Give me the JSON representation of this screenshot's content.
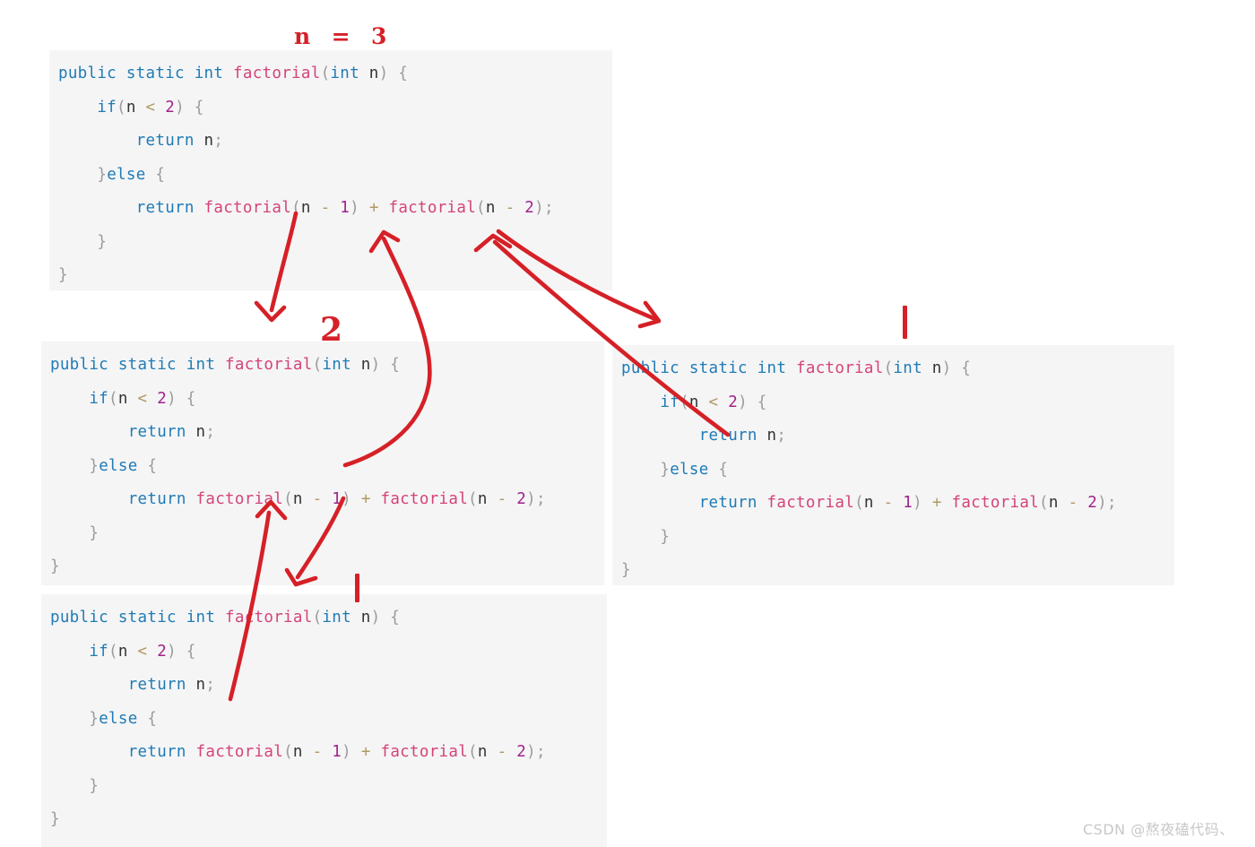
{
  "title": {
    "text": "n  =  3",
    "color": "#D62027"
  },
  "syntax_colors": {
    "keyword": "#1F7BB6",
    "function": "#D4437A",
    "punctuation": "#9b9b9b",
    "variable": "#333333",
    "number": "#A0228C",
    "operator": "#B09A63",
    "block_background": "#f5f5f5",
    "annotation_red": "#D62027"
  },
  "code_blocks": [
    {
      "id": "block-top-left",
      "lines": [
        [
          {
            "t": "public static int ",
            "c": "kw"
          },
          {
            "t": "factorial",
            "c": "fn"
          },
          {
            "t": "(",
            "c": "pun"
          },
          {
            "t": "int",
            "c": "kw"
          },
          {
            "t": " ",
            "c": "pun"
          },
          {
            "t": "n",
            "c": "var"
          },
          {
            "t": ")",
            "c": "pun"
          },
          {
            "t": " {",
            "c": "pun"
          }
        ],
        [
          {
            "t": "    ",
            "c": "pun"
          },
          {
            "t": "if",
            "c": "kw"
          },
          {
            "t": "(",
            "c": "pun"
          },
          {
            "t": "n",
            "c": "var"
          },
          {
            "t": " ",
            "c": "pun"
          },
          {
            "t": "<",
            "c": "op"
          },
          {
            "t": " ",
            "c": "pun"
          },
          {
            "t": "2",
            "c": "num"
          },
          {
            "t": ")",
            "c": "pun"
          },
          {
            "t": " {",
            "c": "pun"
          }
        ],
        [
          {
            "t": "        ",
            "c": "pun"
          },
          {
            "t": "return",
            "c": "kw"
          },
          {
            "t": " ",
            "c": "pun"
          },
          {
            "t": "n",
            "c": "var"
          },
          {
            "t": ";",
            "c": "pun"
          }
        ],
        [
          {
            "t": "    ",
            "c": "pun"
          },
          {
            "t": "}",
            "c": "pun"
          },
          {
            "t": "else",
            "c": "kw"
          },
          {
            "t": " {",
            "c": "pun"
          }
        ],
        [
          {
            "t": "        ",
            "c": "pun"
          },
          {
            "t": "return",
            "c": "kw"
          },
          {
            "t": " ",
            "c": "pun"
          },
          {
            "t": "factorial",
            "c": "fn"
          },
          {
            "t": "(",
            "c": "pun"
          },
          {
            "t": "n",
            "c": "var"
          },
          {
            "t": " ",
            "c": "pun"
          },
          {
            "t": "-",
            "c": "op"
          },
          {
            "t": " ",
            "c": "pun"
          },
          {
            "t": "1",
            "c": "num"
          },
          {
            "t": ")",
            "c": "pun"
          },
          {
            "t": " ",
            "c": "pun"
          },
          {
            "t": "+",
            "c": "op"
          },
          {
            "t": " ",
            "c": "pun"
          },
          {
            "t": "factorial",
            "c": "fn"
          },
          {
            "t": "(",
            "c": "pun"
          },
          {
            "t": "n",
            "c": "var"
          },
          {
            "t": " ",
            "c": "pun"
          },
          {
            "t": "-",
            "c": "op"
          },
          {
            "t": " ",
            "c": "pun"
          },
          {
            "t": "2",
            "c": "num"
          },
          {
            "t": ");",
            "c": "pun"
          }
        ],
        [
          {
            "t": "    ",
            "c": "pun"
          },
          {
            "t": "}",
            "c": "pun"
          }
        ],
        [
          {
            "t": "}",
            "c": "pun"
          }
        ]
      ]
    },
    {
      "id": "block-middle-left",
      "lines": [
        [
          {
            "t": "public static int ",
            "c": "kw"
          },
          {
            "t": "factorial",
            "c": "fn"
          },
          {
            "t": "(",
            "c": "pun"
          },
          {
            "t": "int",
            "c": "kw"
          },
          {
            "t": " ",
            "c": "pun"
          },
          {
            "t": "n",
            "c": "var"
          },
          {
            "t": ")",
            "c": "pun"
          },
          {
            "t": " {",
            "c": "pun"
          }
        ],
        [
          {
            "t": "    ",
            "c": "pun"
          },
          {
            "t": "if",
            "c": "kw"
          },
          {
            "t": "(",
            "c": "pun"
          },
          {
            "t": "n",
            "c": "var"
          },
          {
            "t": " ",
            "c": "pun"
          },
          {
            "t": "<",
            "c": "op"
          },
          {
            "t": " ",
            "c": "pun"
          },
          {
            "t": "2",
            "c": "num"
          },
          {
            "t": ")",
            "c": "pun"
          },
          {
            "t": " {",
            "c": "pun"
          }
        ],
        [
          {
            "t": "        ",
            "c": "pun"
          },
          {
            "t": "return",
            "c": "kw"
          },
          {
            "t": " ",
            "c": "pun"
          },
          {
            "t": "n",
            "c": "var"
          },
          {
            "t": ";",
            "c": "pun"
          }
        ],
        [
          {
            "t": "    ",
            "c": "pun"
          },
          {
            "t": "}",
            "c": "pun"
          },
          {
            "t": "else",
            "c": "kw"
          },
          {
            "t": " {",
            "c": "pun"
          }
        ],
        [
          {
            "t": "        ",
            "c": "pun"
          },
          {
            "t": "return",
            "c": "kw"
          },
          {
            "t": " ",
            "c": "pun"
          },
          {
            "t": "factorial",
            "c": "fn"
          },
          {
            "t": "(",
            "c": "pun"
          },
          {
            "t": "n",
            "c": "var"
          },
          {
            "t": " ",
            "c": "pun"
          },
          {
            "t": "-",
            "c": "op"
          },
          {
            "t": " ",
            "c": "pun"
          },
          {
            "t": "1",
            "c": "num"
          },
          {
            "t": ")",
            "c": "pun"
          },
          {
            "t": " ",
            "c": "pun"
          },
          {
            "t": "+",
            "c": "op"
          },
          {
            "t": " ",
            "c": "pun"
          },
          {
            "t": "factorial",
            "c": "fn"
          },
          {
            "t": "(",
            "c": "pun"
          },
          {
            "t": "n",
            "c": "var"
          },
          {
            "t": " ",
            "c": "pun"
          },
          {
            "t": "-",
            "c": "op"
          },
          {
            "t": " ",
            "c": "pun"
          },
          {
            "t": "2",
            "c": "num"
          },
          {
            "t": ");",
            "c": "pun"
          }
        ],
        [
          {
            "t": "    ",
            "c": "pun"
          },
          {
            "t": "}",
            "c": "pun"
          }
        ],
        [
          {
            "t": "}",
            "c": "pun"
          }
        ]
      ]
    },
    {
      "id": "block-bottom-left",
      "lines": [
        [
          {
            "t": "public static int ",
            "c": "kw"
          },
          {
            "t": "factorial",
            "c": "fn"
          },
          {
            "t": "(",
            "c": "pun"
          },
          {
            "t": "int",
            "c": "kw"
          },
          {
            "t": " ",
            "c": "pun"
          },
          {
            "t": "n",
            "c": "var"
          },
          {
            "t": ")",
            "c": "pun"
          },
          {
            "t": " {",
            "c": "pun"
          }
        ],
        [
          {
            "t": "    ",
            "c": "pun"
          },
          {
            "t": "if",
            "c": "kw"
          },
          {
            "t": "(",
            "c": "pun"
          },
          {
            "t": "n",
            "c": "var"
          },
          {
            "t": " ",
            "c": "pun"
          },
          {
            "t": "<",
            "c": "op"
          },
          {
            "t": " ",
            "c": "pun"
          },
          {
            "t": "2",
            "c": "num"
          },
          {
            "t": ")",
            "c": "pun"
          },
          {
            "t": " {",
            "c": "pun"
          }
        ],
        [
          {
            "t": "        ",
            "c": "pun"
          },
          {
            "t": "return",
            "c": "kw"
          },
          {
            "t": " ",
            "c": "pun"
          },
          {
            "t": "n",
            "c": "var"
          },
          {
            "t": ";",
            "c": "pun"
          }
        ],
        [
          {
            "t": "    ",
            "c": "pun"
          },
          {
            "t": "}",
            "c": "pun"
          },
          {
            "t": "else",
            "c": "kw"
          },
          {
            "t": " {",
            "c": "pun"
          }
        ],
        [
          {
            "t": "        ",
            "c": "pun"
          },
          {
            "t": "return",
            "c": "kw"
          },
          {
            "t": " ",
            "c": "pun"
          },
          {
            "t": "factorial",
            "c": "fn"
          },
          {
            "t": "(",
            "c": "pun"
          },
          {
            "t": "n",
            "c": "var"
          },
          {
            "t": " ",
            "c": "pun"
          },
          {
            "t": "-",
            "c": "op"
          },
          {
            "t": " ",
            "c": "pun"
          },
          {
            "t": "1",
            "c": "num"
          },
          {
            "t": ")",
            "c": "pun"
          },
          {
            "t": " ",
            "c": "pun"
          },
          {
            "t": "+",
            "c": "op"
          },
          {
            "t": " ",
            "c": "pun"
          },
          {
            "t": "factorial",
            "c": "fn"
          },
          {
            "t": "(",
            "c": "pun"
          },
          {
            "t": "n",
            "c": "var"
          },
          {
            "t": " ",
            "c": "pun"
          },
          {
            "t": "-",
            "c": "op"
          },
          {
            "t": " ",
            "c": "pun"
          },
          {
            "t": "2",
            "c": "num"
          },
          {
            "t": ");",
            "c": "pun"
          }
        ],
        [
          {
            "t": "    ",
            "c": "pun"
          },
          {
            "t": "}",
            "c": "pun"
          }
        ],
        [
          {
            "t": "}",
            "c": "pun"
          }
        ]
      ]
    },
    {
      "id": "block-right",
      "lines": [
        [
          {
            "t": "public static int ",
            "c": "kw"
          },
          {
            "t": "factorial",
            "c": "fn"
          },
          {
            "t": "(",
            "c": "pun"
          },
          {
            "t": "int",
            "c": "kw"
          },
          {
            "t": " ",
            "c": "pun"
          },
          {
            "t": "n",
            "c": "var"
          },
          {
            "t": ")",
            "c": "pun"
          },
          {
            "t": " {",
            "c": "pun"
          }
        ],
        [
          {
            "t": "    ",
            "c": "pun"
          },
          {
            "t": "if",
            "c": "kw"
          },
          {
            "t": "(",
            "c": "pun"
          },
          {
            "t": "n",
            "c": "var"
          },
          {
            "t": " ",
            "c": "pun"
          },
          {
            "t": "<",
            "c": "op"
          },
          {
            "t": " ",
            "c": "pun"
          },
          {
            "t": "2",
            "c": "num"
          },
          {
            "t": ")",
            "c": "pun"
          },
          {
            "t": " {",
            "c": "pun"
          }
        ],
        [
          {
            "t": "        ",
            "c": "pun"
          },
          {
            "t": "return",
            "c": "kw"
          },
          {
            "t": " ",
            "c": "pun"
          },
          {
            "t": "n",
            "c": "var"
          },
          {
            "t": ";",
            "c": "pun"
          }
        ],
        [
          {
            "t": "    ",
            "c": "pun"
          },
          {
            "t": "}",
            "c": "pun"
          },
          {
            "t": "else",
            "c": "kw"
          },
          {
            "t": " {",
            "c": "pun"
          }
        ],
        [
          {
            "t": "        ",
            "c": "pun"
          },
          {
            "t": "return",
            "c": "kw"
          },
          {
            "t": " ",
            "c": "pun"
          },
          {
            "t": "factorial",
            "c": "fn"
          },
          {
            "t": "(",
            "c": "pun"
          },
          {
            "t": "n",
            "c": "var"
          },
          {
            "t": " ",
            "c": "pun"
          },
          {
            "t": "-",
            "c": "op"
          },
          {
            "t": " ",
            "c": "pun"
          },
          {
            "t": "1",
            "c": "num"
          },
          {
            "t": ")",
            "c": "pun"
          },
          {
            "t": " ",
            "c": "pun"
          },
          {
            "t": "+",
            "c": "op"
          },
          {
            "t": " ",
            "c": "pun"
          },
          {
            "t": "factorial",
            "c": "fn"
          },
          {
            "t": "(",
            "c": "pun"
          },
          {
            "t": "n",
            "c": "var"
          },
          {
            "t": " ",
            "c": "pun"
          },
          {
            "t": "-",
            "c": "op"
          },
          {
            "t": " ",
            "c": "pun"
          },
          {
            "t": "2",
            "c": "num"
          },
          {
            "t": ");",
            "c": "pun"
          }
        ],
        [
          {
            "t": "    ",
            "c": "pun"
          },
          {
            "t": "}",
            "c": "pun"
          }
        ],
        [
          {
            "t": "}",
            "c": "pun"
          }
        ]
      ]
    }
  ],
  "annotations": {
    "label_two": "2",
    "tick_one_middle": "1",
    "tick_one_bottom": "1"
  },
  "watermark": {
    "text": "CSDN @熬夜磕代码、"
  }
}
